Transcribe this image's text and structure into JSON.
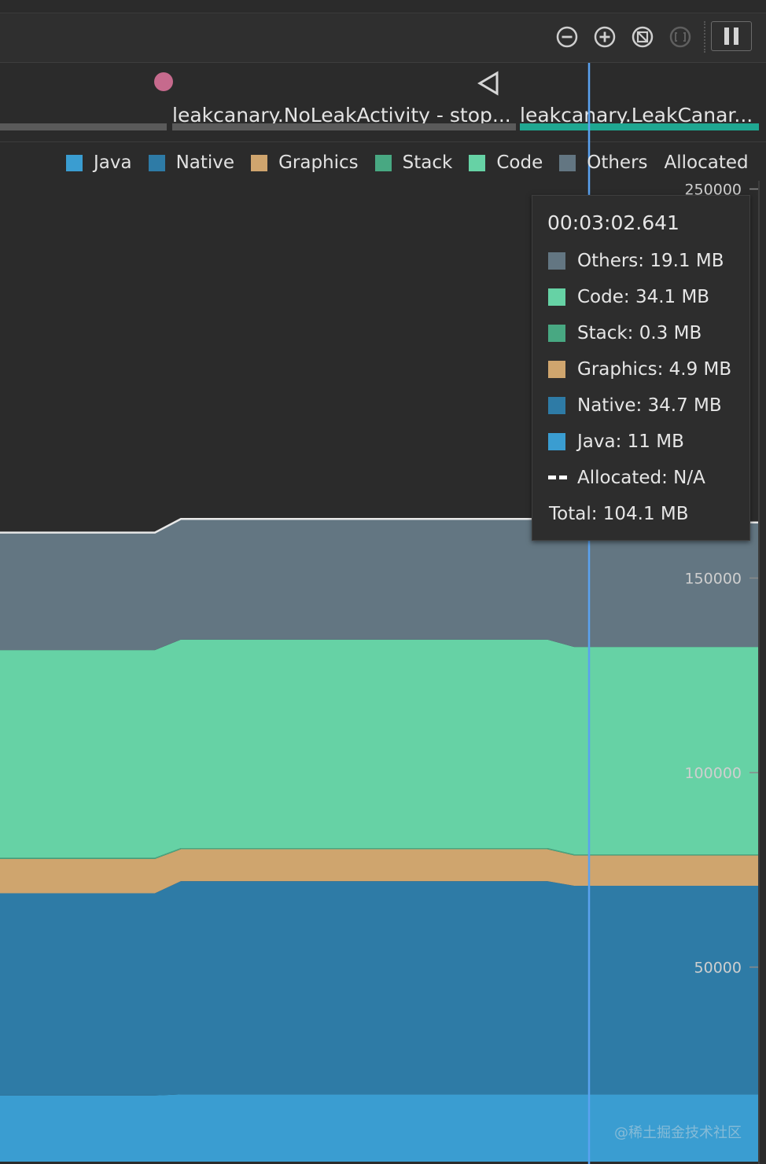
{
  "toolbar": {
    "buttons": [
      {
        "icon": "zoom-out-icon"
      },
      {
        "icon": "zoom-in-icon"
      },
      {
        "icon": "reset-zoom-icon"
      },
      {
        "icon": "zoom-to-selection-icon"
      },
      {
        "icon": "pause-icon"
      }
    ]
  },
  "events": {
    "activity_1": "leakcanary.NoLeakActivity - stop...",
    "activity_2": "leakcanary.LeakCanar..."
  },
  "legend": [
    {
      "label": "Java",
      "color": "#3a9dd1"
    },
    {
      "label": "Native",
      "color": "#2e7ba6"
    },
    {
      "label": "Graphics",
      "color": "#cfa56e"
    },
    {
      "label": "Stack",
      "color": "#48a882"
    },
    {
      "label": "Code",
      "color": "#66d2a5"
    },
    {
      "label": "Others",
      "color": "#637682"
    },
    {
      "label": "Allocated"
    }
  ],
  "tooltip": {
    "time": "00:03:02.641",
    "rows": [
      {
        "label": "Others: 19.1 MB",
        "color": "#637682"
      },
      {
        "label": "Code: 34.1 MB",
        "color": "#66d2a5"
      },
      {
        "label": "Stack: 0.3 MB",
        "color": "#48a882"
      },
      {
        "label": "Graphics: 4.9 MB",
        "color": "#cfa56e"
      },
      {
        "label": "Native: 34.7 MB",
        "color": "#2e7ba6"
      },
      {
        "label": "Java: 11 MB",
        "color": "#3a9dd1"
      },
      {
        "label": "Allocated: N/A"
      }
    ],
    "total": "Total: 104.1 MB"
  },
  "chart_data": {
    "type": "area",
    "stacked": true,
    "x": [
      0,
      1,
      2,
      3,
      4
    ],
    "yticks": [
      "250000",
      "150000",
      "100000",
      "50000"
    ],
    "y_axis_values": [
      250000,
      150000,
      100000,
      50000
    ],
    "ylim": [
      0,
      250000
    ],
    "series": [
      {
        "name": "Java",
        "color": "#3a9dd1",
        "values": [
          17000,
          17000,
          17300,
          17300,
          17300
        ]
      },
      {
        "name": "Native",
        "color": "#2e7ba6",
        "values": [
          52000,
          52000,
          54800,
          54800,
          53600
        ]
      },
      {
        "name": "Graphics",
        "color": "#cfa56e",
        "values": [
          8800,
          8800,
          8200,
          8200,
          7800
        ]
      },
      {
        "name": "Stack",
        "color": "#48a882",
        "values": [
          300,
          300,
          300,
          300,
          300
        ]
      },
      {
        "name": "Code",
        "color": "#66d2a5",
        "values": [
          53400,
          53400,
          53600,
          53600,
          53300
        ]
      },
      {
        "name": "Others",
        "color": "#637682",
        "values": [
          30200,
          30200,
          31000,
          31000,
          32000
        ]
      }
    ],
    "grid": false,
    "legend_position": "top"
  },
  "watermark": "@稀土掘金技术社区"
}
